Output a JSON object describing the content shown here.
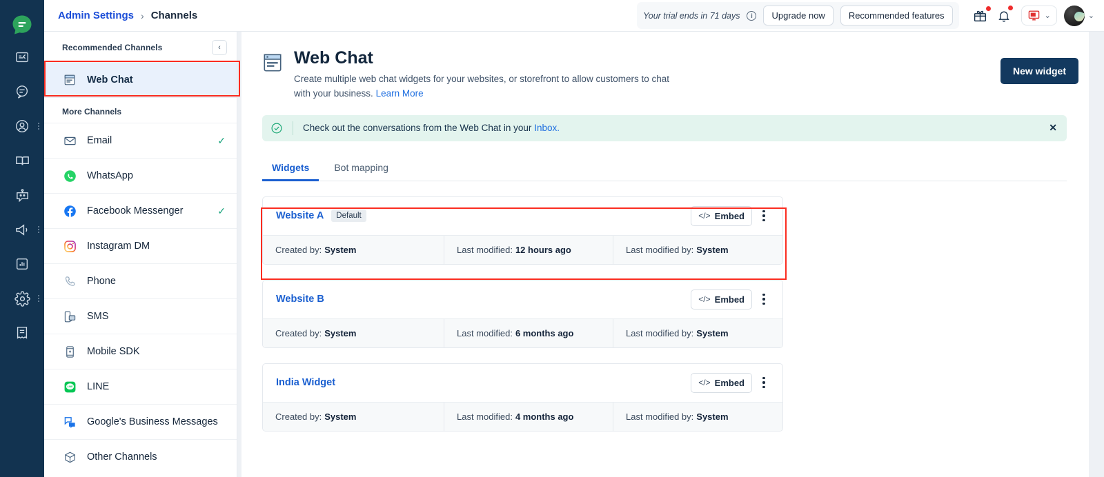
{
  "app": {
    "logo_icon": "chat-bubble-logo"
  },
  "rail": {
    "items": [
      {
        "name": "inbox-icon",
        "has_dots": false
      },
      {
        "name": "conversations-icon",
        "has_dots": false
      },
      {
        "name": "contacts-icon",
        "has_dots": true
      },
      {
        "name": "knowledge-base-icon",
        "has_dots": false
      },
      {
        "name": "bot-icon",
        "has_dots": false
      },
      {
        "name": "campaigns-icon",
        "has_dots": true
      },
      {
        "name": "reports-icon",
        "has_dots": false
      },
      {
        "name": "settings-icon",
        "has_dots": true
      },
      {
        "name": "notes-icon",
        "has_dots": false
      }
    ]
  },
  "topbar": {
    "breadcrumb": {
      "parent": "Admin Settings",
      "separator": "›",
      "current": "Channels"
    },
    "trial_text": "Your trial ends in 71 days",
    "info_glyph": "i",
    "upgrade_label": "Upgrade now",
    "recommended_label": "Recommended features",
    "gift_icon": "gift-icon",
    "bell_icon": "bell-icon",
    "device_icon": "monitor-icon",
    "chevron": "⌄"
  },
  "sidebar": {
    "recommended_heading": "Recommended Channels",
    "collapse_glyph": "‹",
    "recommended": [
      {
        "label": "Web Chat",
        "icon": "web-chat-icon",
        "active": true,
        "connected": false
      }
    ],
    "more_heading": "More Channels",
    "more": [
      {
        "label": "Email",
        "icon": "email-icon",
        "connected": true
      },
      {
        "label": "WhatsApp",
        "icon": "whatsapp-icon",
        "connected": false
      },
      {
        "label": "Facebook Messenger",
        "icon": "facebook-icon",
        "connected": true
      },
      {
        "label": "Instagram DM",
        "icon": "instagram-icon",
        "connected": false
      },
      {
        "label": "Phone",
        "icon": "phone-icon",
        "connected": false
      },
      {
        "label": "SMS",
        "icon": "sms-icon",
        "connected": false
      },
      {
        "label": "Mobile SDK",
        "icon": "mobile-sdk-icon",
        "connected": false
      },
      {
        "label": "LINE",
        "icon": "line-icon",
        "connected": false
      },
      {
        "label": "Google's Business Messages",
        "icon": "google-business-messages-icon",
        "connected": false
      },
      {
        "label": "Other Channels",
        "icon": "other-channels-icon",
        "connected": false
      }
    ]
  },
  "main": {
    "page_icon": "web-chat-icon",
    "title": "Web Chat",
    "description": "Create multiple web chat widgets for your websites, or storefront to allow customers to chat with your business.",
    "learn_more": "Learn More",
    "new_widget_label": "New widget",
    "banner": {
      "icon": "check-circle-icon",
      "text": "Check out the conversations from the Web Chat in your",
      "link": "Inbox.",
      "close_glyph": "✕"
    },
    "tabs": [
      {
        "label": "Widgets",
        "active": true
      },
      {
        "label": "Bot mapping",
        "active": false
      }
    ],
    "meta_labels": {
      "created_by": "Created by:",
      "last_modified": "Last modified:",
      "last_modified_by": "Last modified by:"
    },
    "embed_label": "Embed",
    "embed_glyph": "</>",
    "widgets": [
      {
        "name": "Website A",
        "badge": "Default",
        "created_by": "System",
        "last_modified": "12 hours ago",
        "last_modified_by": "System",
        "highlighted": true
      },
      {
        "name": "Website B",
        "badge": "",
        "created_by": "System",
        "last_modified": "6 months ago",
        "last_modified_by": "System",
        "highlighted": false
      },
      {
        "name": "India Widget",
        "badge": "",
        "created_by": "System",
        "last_modified": "4 months ago",
        "last_modified_by": "System",
        "highlighted": false
      }
    ]
  },
  "colors": {
    "rail_bg": "#123350",
    "accent_blue": "#1a5fd0",
    "primary_btn": "#13395f",
    "banner_bg": "#e3f4ee",
    "highlight_red": "#fb2c20",
    "active_item_bg": "#e9f1fc",
    "success_green": "#16a37b"
  }
}
